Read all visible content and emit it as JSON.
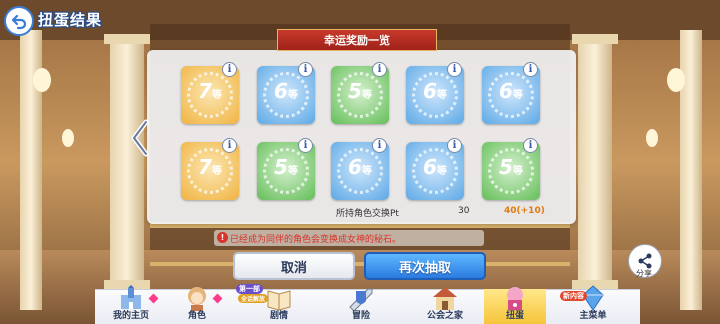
{
  "header": {
    "title": "扭蛋结果"
  },
  "panel": {
    "banner": "幸运奖励一览",
    "cards": [
      {
        "grade": "7",
        "unit": "等",
        "color": "gold"
      },
      {
        "grade": "6",
        "unit": "等",
        "color": "blue"
      },
      {
        "grade": "5",
        "unit": "等",
        "color": "green"
      },
      {
        "grade": "6",
        "unit": "等",
        "color": "blue"
      },
      {
        "grade": "6",
        "unit": "等",
        "color": "blue"
      },
      {
        "grade": "7",
        "unit": "等",
        "color": "gold"
      },
      {
        "grade": "5",
        "unit": "等",
        "color": "green"
      },
      {
        "grade": "6",
        "unit": "等",
        "color": "blue"
      },
      {
        "grade": "6",
        "unit": "等",
        "color": "blue"
      },
      {
        "grade": "5",
        "unit": "等",
        "color": "green"
      }
    ],
    "info_glyph": "i",
    "pt_label": "所持角色交换Pt",
    "pt_value": "30",
    "pt_new": "40(+10)"
  },
  "notice": {
    "icon": "!",
    "text": "已经成为同伴的角色会变换成女神的秘石。"
  },
  "buttons": {
    "cancel": "取消",
    "draw_again": "再次抽取"
  },
  "share": {
    "label": "分享"
  },
  "nav": {
    "items": [
      {
        "label": "我的主页"
      },
      {
        "label": "角色"
      },
      {
        "label": "剧情"
      },
      {
        "label": "冒险"
      },
      {
        "label": "公会之家"
      },
      {
        "label": "扭蛋",
        "active": true
      },
      {
        "label": "主菜单"
      }
    ],
    "badges": {
      "story": "第一部",
      "story_sub": "全话解放",
      "menu": "新内容"
    }
  },
  "colors": {
    "gold": "#f3b545",
    "blue": "#6fb4ea",
    "green": "#76c96b",
    "accent": "#2a7be0",
    "warning": "#d8342a"
  }
}
